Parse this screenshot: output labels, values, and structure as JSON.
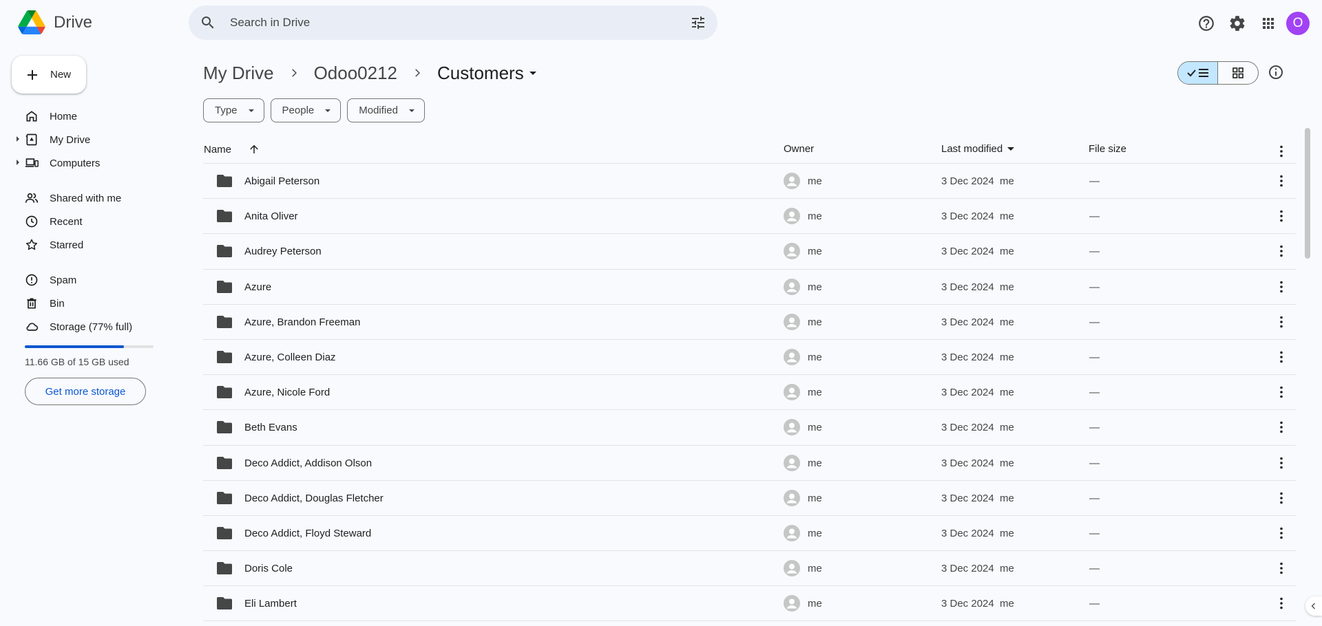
{
  "app": {
    "name": "Drive"
  },
  "search": {
    "placeholder": "Search in Drive"
  },
  "header": {
    "avatar_initial": "O"
  },
  "sidebar": {
    "new_label": "New",
    "items": [
      {
        "label": "Home",
        "icon": "home-icon"
      },
      {
        "label": "My Drive",
        "icon": "my-drive-icon"
      },
      {
        "label": "Computers",
        "icon": "computers-icon"
      },
      {
        "label": "Shared with me",
        "icon": "shared-icon"
      },
      {
        "label": "Recent",
        "icon": "clock-icon"
      },
      {
        "label": "Starred",
        "icon": "star-icon"
      },
      {
        "label": "Spam",
        "icon": "spam-icon"
      },
      {
        "label": "Bin",
        "icon": "trash-icon"
      },
      {
        "label": "Storage (77% full)",
        "icon": "cloud-icon"
      }
    ],
    "storage": {
      "used_fraction": 0.77,
      "text": "11.66 GB of 15 GB used",
      "button": "Get more storage"
    }
  },
  "breadcrumb": {
    "items": [
      "My Drive",
      "Odoo0212"
    ],
    "current": "Customers"
  },
  "filters": [
    "Type",
    "People",
    "Modified"
  ],
  "table": {
    "columns": {
      "name": "Name",
      "owner": "Owner",
      "modified": "Last modified",
      "size": "File size"
    },
    "rows": [
      {
        "name": "Abigail Peterson",
        "owner": "me",
        "modified": "3 Dec 2024  me",
        "size": "—"
      },
      {
        "name": "Anita Oliver",
        "owner": "me",
        "modified": "3 Dec 2024  me",
        "size": "—"
      },
      {
        "name": "Audrey Peterson",
        "owner": "me",
        "modified": "3 Dec 2024  me",
        "size": "—"
      },
      {
        "name": "Azure",
        "owner": "me",
        "modified": "3 Dec 2024  me",
        "size": "—"
      },
      {
        "name": "Azure, Brandon Freeman",
        "owner": "me",
        "modified": "3 Dec 2024  me",
        "size": "—"
      },
      {
        "name": "Azure, Colleen Diaz",
        "owner": "me",
        "modified": "3 Dec 2024  me",
        "size": "—"
      },
      {
        "name": "Azure, Nicole Ford",
        "owner": "me",
        "modified": "3 Dec 2024  me",
        "size": "—"
      },
      {
        "name": "Beth Evans",
        "owner": "me",
        "modified": "3 Dec 2024  me",
        "size": "—"
      },
      {
        "name": "Deco Addict, Addison Olson",
        "owner": "me",
        "modified": "3 Dec 2024  me",
        "size": "—"
      },
      {
        "name": "Deco Addict, Douglas Fletcher",
        "owner": "me",
        "modified": "3 Dec 2024  me",
        "size": "—"
      },
      {
        "name": "Deco Addict, Floyd Steward",
        "owner": "me",
        "modified": "3 Dec 2024  me",
        "size": "—"
      },
      {
        "name": "Doris Cole",
        "owner": "me",
        "modified": "3 Dec 2024  me",
        "size": "—"
      },
      {
        "name": "Eli Lambert",
        "owner": "me",
        "modified": "3 Dec 2024  me",
        "size": "—"
      }
    ]
  },
  "colors": {
    "accent": "#0b57d0",
    "avatar": "#a142f4",
    "selected_view": "#c2e7ff"
  }
}
